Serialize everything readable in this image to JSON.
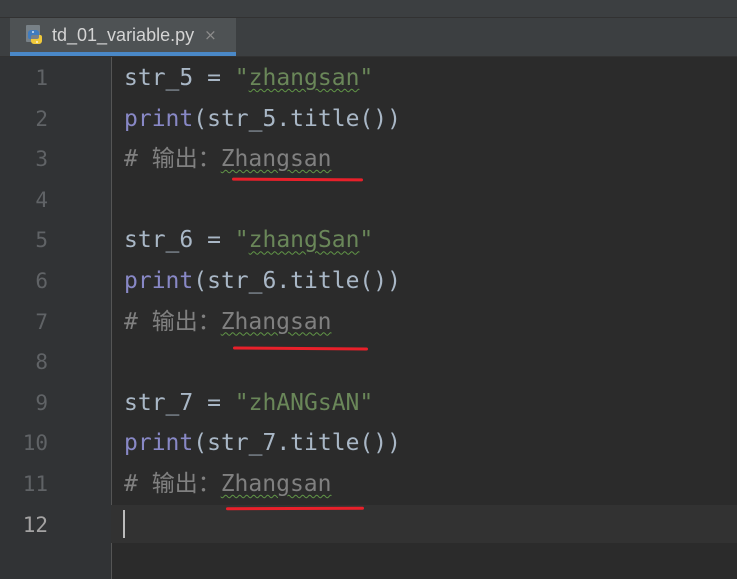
{
  "tab": {
    "filename": "td_01_variable.py",
    "close_glyph": "×",
    "icon": "python-file-icon"
  },
  "lines": [
    {
      "num": "1",
      "parts": [
        {
          "t": "str_5 = ",
          "c": "plain"
        },
        {
          "t": "\"",
          "c": "str"
        },
        {
          "t": "zhangsan",
          "c": "str typo"
        },
        {
          "t": "\"",
          "c": "str"
        }
      ]
    },
    {
      "num": "2",
      "parts": [
        {
          "t": "print",
          "c": "kw-builtin"
        },
        {
          "t": "(str_5.title())",
          "c": "plain"
        }
      ]
    },
    {
      "num": "3",
      "parts": [
        {
          "t": "# 输出：",
          "c": "cmt"
        },
        {
          "t": "Zhangsan",
          "c": "cmt typo"
        }
      ]
    },
    {
      "num": "4",
      "parts": []
    },
    {
      "num": "5",
      "parts": [
        {
          "t": "str_6 = ",
          "c": "plain"
        },
        {
          "t": "\"",
          "c": "str"
        },
        {
          "t": "zhangSan",
          "c": "str typo"
        },
        {
          "t": "\"",
          "c": "str"
        }
      ]
    },
    {
      "num": "6",
      "parts": [
        {
          "t": "print",
          "c": "kw-builtin"
        },
        {
          "t": "(str_6.title())",
          "c": "plain"
        }
      ]
    },
    {
      "num": "7",
      "parts": [
        {
          "t": "# 输出：",
          "c": "cmt"
        },
        {
          "t": "Zhangsan",
          "c": "cmt typo"
        }
      ]
    },
    {
      "num": "8",
      "parts": []
    },
    {
      "num": "9",
      "parts": [
        {
          "t": "str_7 = ",
          "c": "plain"
        },
        {
          "t": "\"zhANGsAN\"",
          "c": "str"
        }
      ]
    },
    {
      "num": "10",
      "parts": [
        {
          "t": "print",
          "c": "kw-builtin"
        },
        {
          "t": "(str_7.title())",
          "c": "plain"
        }
      ]
    },
    {
      "num": "11",
      "parts": [
        {
          "t": "# 输出：",
          "c": "cmt"
        },
        {
          "t": "Zhangsan",
          "c": "cmt typo"
        }
      ]
    },
    {
      "num": "12",
      "parts": []
    }
  ],
  "active_line": "12",
  "colors": {
    "editor_bg": "#2b2b2b",
    "gutter_bg": "#313335",
    "string": "#6a8759",
    "builtin": "#8888c6",
    "comment": "#808080",
    "plain": "#a9b7c6",
    "annotation_red": "#e8202a"
  }
}
